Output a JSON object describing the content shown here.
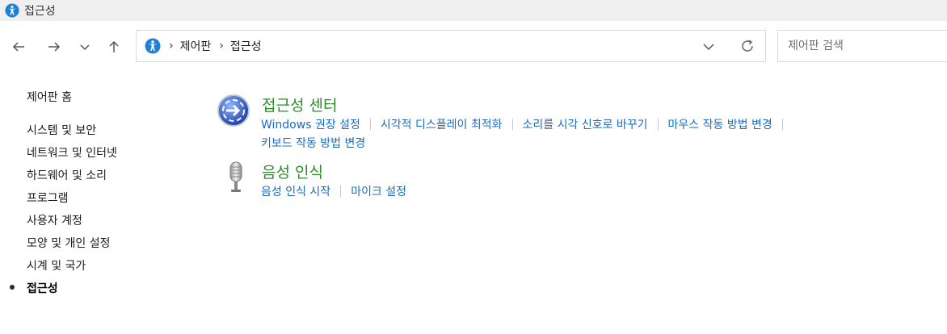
{
  "window": {
    "title": "접근성"
  },
  "address": {
    "crumbs": [
      "제어판",
      "접근성"
    ]
  },
  "search": {
    "placeholder": "제어판 검색"
  },
  "sidebar": {
    "home": "제어판 홈",
    "items": [
      {
        "label": "시스템 및 보안"
      },
      {
        "label": "네트워크 및 인터넷"
      },
      {
        "label": "하드웨어 및 소리"
      },
      {
        "label": "프로그램"
      },
      {
        "label": "사용자 계정"
      },
      {
        "label": "모양 및 개인 설정"
      },
      {
        "label": "시계 및 국가"
      },
      {
        "label": "접근성"
      }
    ]
  },
  "categories": [
    {
      "title": "접근성 센터",
      "icon": "ease-of-access-center-icon",
      "links": [
        "Windows 권장 설정",
        "시각적 디스플레이 최적화",
        "소리를 시각 신호로 바꾸기",
        "마우스 작동 방법 변경",
        "키보드 작동 방법 변경"
      ]
    },
    {
      "title": "음성 인식",
      "icon": "microphone-icon",
      "links": [
        "음성 인식 시작",
        "마이크 설정"
      ]
    }
  ],
  "colors": {
    "category_title": "#2a8c2a",
    "link": "#1a6bbf",
    "accessibility_blue": "#1f7fd6"
  }
}
